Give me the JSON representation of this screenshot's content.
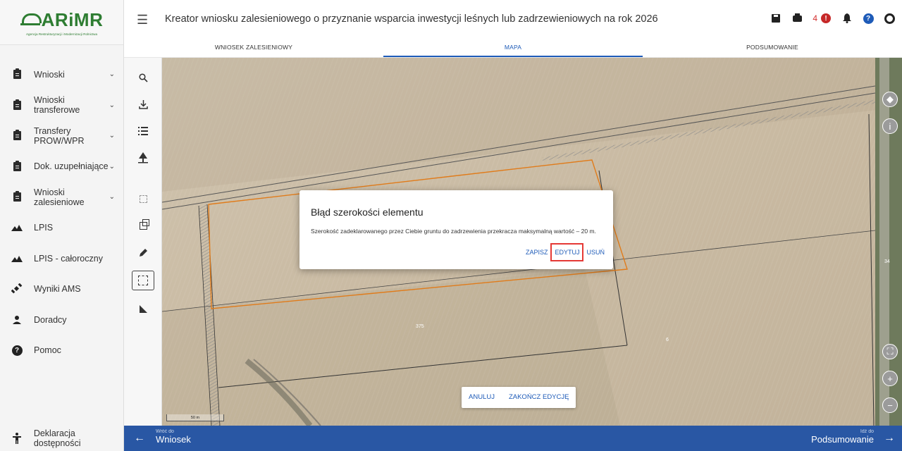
{
  "logo": {
    "name": "ARiMR",
    "subtitle": "Agencja Restrukturyzacji i Modernizacji Rolnictwa"
  },
  "header": {
    "title": "Kreator wniosku zalesieniowego o przyznanie wsparcia inwestycji leśnych lub zadrzewieniowych na rok 2026",
    "notification_count": "4"
  },
  "tabs": [
    {
      "label": "WNIOSEK ZALESIENIOWY",
      "active": false
    },
    {
      "label": "MAPA",
      "active": true
    },
    {
      "label": "PODSUMOWANIE",
      "active": false
    }
  ],
  "sidebar": {
    "items": [
      {
        "label": "Wnioski",
        "icon": "clipboard-icon",
        "has_chevron": true
      },
      {
        "label": "Wnioski transferowe",
        "icon": "clipboard-icon",
        "has_chevron": true
      },
      {
        "label": "Transfery PROW/WPR",
        "icon": "clipboard-icon",
        "has_chevron": true
      },
      {
        "label": "Dok. uzupełniające",
        "icon": "clipboard-icon",
        "has_chevron": true
      },
      {
        "label": "Wnioski zalesieniowe",
        "icon": "clipboard-icon",
        "has_chevron": true
      },
      {
        "label": "LPIS",
        "icon": "terrain-icon",
        "has_chevron": false
      },
      {
        "label": "LPIS - całoroczny",
        "icon": "terrain-icon",
        "has_chevron": false
      },
      {
        "label": "Wyniki AMS",
        "icon": "satellite-icon",
        "has_chevron": false
      },
      {
        "label": "Doradcy",
        "icon": "person-icon",
        "has_chevron": false
      },
      {
        "label": "Pomoc",
        "icon": "help-icon",
        "has_chevron": false
      }
    ],
    "accessibility": "Deklaracja dostępności"
  },
  "map": {
    "parcel_labels": [
      "375",
      "6",
      "34"
    ],
    "scale_label": "50 m",
    "edit_bar": {
      "cancel": "ANULUJ",
      "finish": "ZAKOŃCZ EDYCJĘ"
    }
  },
  "modal": {
    "title": "Błąd szerokości elementu",
    "message": "Szerokość zadeklarowanego przez Ciebie gruntu do zadrzewienia przekracza maksymalną wartość – 20 m.",
    "buttons": {
      "save": "ZAPISZ",
      "edit": "EDYTUJ",
      "delete": "USUŃ"
    },
    "highlighted_button": "EDYTUJ"
  },
  "footer": {
    "back_small": "Wróć do",
    "back_big": "Wniosek",
    "next_small": "Idź do",
    "next_big": "Podsumowanie"
  },
  "colors": {
    "accent": "#2957a4",
    "link": "#1e5bb8",
    "logo": "#2e7d32",
    "highlight": "#e53935",
    "parcel_outline": "#e07b1a"
  }
}
